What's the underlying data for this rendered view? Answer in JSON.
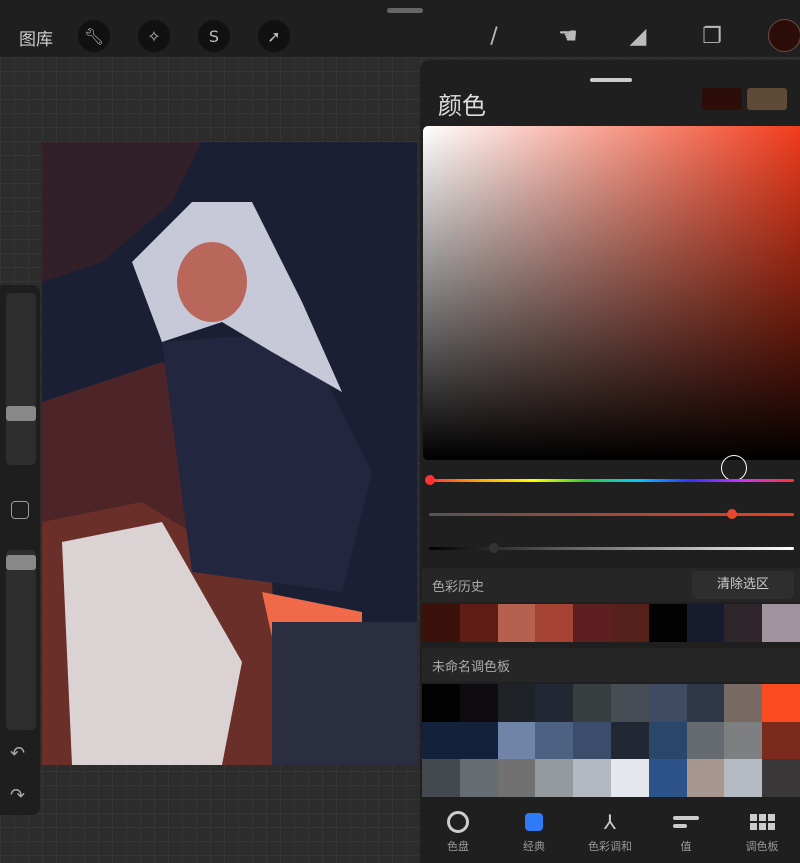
{
  "topbar": {
    "gallery": "图库",
    "left_tools": [
      "wrench-icon",
      "magic-wand-icon",
      "selection-icon",
      "move-arrow-icon"
    ],
    "right_tools": [
      "brush-icon",
      "smudge-icon",
      "eraser-icon",
      "layers-icon"
    ],
    "current_color": "#2c0d08"
  },
  "panel": {
    "title": "颜色",
    "primary_swatch": "#2c0d08",
    "secondary_swatch": "#5f4a35",
    "history": {
      "label": "色彩历史",
      "clear": "清除选区",
      "colors": [
        "#3a110b",
        "#5e1e15",
        "#b6604f",
        "#a54432",
        "#5e1f20",
        "#56211a",
        "#020202",
        "#161c2e",
        "#2f262c",
        "#a2949f"
      ]
    },
    "palette": {
      "label": "未命名调色板",
      "colors": [
        "#020202",
        "#0e0c10",
        "#1f2226",
        "#212834",
        "#363e40",
        "#464d55",
        "#3e4b62",
        "#2e3849",
        "#786a62",
        "#f94a20",
        "#14213a",
        "#13213a",
        "#6f84a7",
        "#4d6282",
        "#3b4d6a",
        "#212733",
        "#2a4669",
        "#656b71",
        "#7d7f81",
        "#7b2a1d",
        "#44494f",
        "#656d72",
        "#717171",
        "#94999d",
        "#b4b9c1",
        "#e4e7ee",
        "#2d538b",
        "#a89790",
        "#b4bbc2",
        "#3a3838"
      ]
    },
    "tabs": [
      {
        "label": "色盘",
        "icon": "disc-icon"
      },
      {
        "label": "经典",
        "icon": "classic-square-icon",
        "active": true
      },
      {
        "label": "色彩调和",
        "icon": "harmony-icon"
      },
      {
        "label": "值",
        "icon": "value-sliders-icon"
      },
      {
        "label": "调色板",
        "icon": "palette-grid-icon"
      }
    ],
    "accent": "#2f7bf6"
  }
}
